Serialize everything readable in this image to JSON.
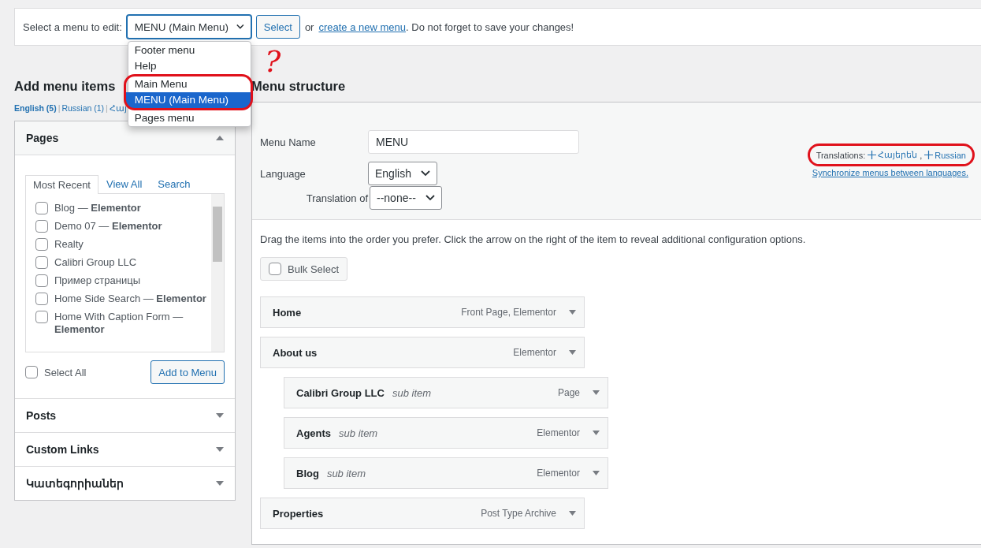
{
  "menu_picker": {
    "label": "Select a menu to edit:",
    "value": "MENU (Main Menu)",
    "button": "Select",
    "or_text": "or",
    "link": "create a new menu",
    "after_link": ". Do not forget to save your changes!",
    "options": [
      {
        "label": "Footer menu",
        "selected": false
      },
      {
        "label": "Help",
        "selected": false
      },
      {
        "label": "Main Menu",
        "selected": false,
        "circled": true
      },
      {
        "label": "MENU (Main Menu)",
        "selected": true,
        "circled": true
      },
      {
        "label": "Pages menu",
        "selected": false
      }
    ]
  },
  "add_items": {
    "heading": "Add menu items",
    "separator": "|",
    "languages": [
      {
        "label": "English (5)",
        "selected": true
      },
      {
        "label": "Russian (1)",
        "selected": false
      },
      {
        "label": "Հայ",
        "selected": false
      }
    ],
    "sections": [
      {
        "title": "Pages",
        "expanded": true
      },
      {
        "title": "Posts",
        "expanded": false
      },
      {
        "title": "Custom Links",
        "expanded": false
      },
      {
        "title": "Կատեգորիաներ",
        "expanded": false
      }
    ],
    "tabs": [
      {
        "label": "Most Recent",
        "selected": true
      },
      {
        "label": "View All",
        "selected": false
      },
      {
        "label": "Search",
        "selected": false
      }
    ],
    "pages": [
      {
        "label": "Blog — **Elementor**",
        "checked": false
      },
      {
        "label": "Demo 07 — **Elementor**",
        "checked": false
      },
      {
        "label": "Realty",
        "checked": false
      },
      {
        "label": "Calibri Group LLC",
        "checked": false
      },
      {
        "label": "Пример страницы",
        "checked": false
      },
      {
        "label": "Home Side Search — **Elementor**",
        "checked": false
      },
      {
        "label": "Home With Caption Form — **Elementor**",
        "checked": false
      }
    ],
    "select_all": {
      "label": "Select All",
      "checked": false
    },
    "add_button": "Add to Menu"
  },
  "structure": {
    "heading": "Menu structure",
    "name_label": "Menu Name",
    "name_value": "MENU",
    "language_label": "Language",
    "language_value": "English",
    "translation_label": "Translation of",
    "translation_value": "--none--",
    "translations": {
      "label": "Translations:",
      "links": [
        "Հայերեն",
        "Russian"
      ],
      "separator": ","
    },
    "sync_link": "Synchronize menus between languages.",
    "instructions": "Drag the items into the order you prefer. Click the arrow on the right of the item to reveal additional configuration options.",
    "bulk_select": {
      "label": "Bulk Select",
      "checked": false
    },
    "items": [
      {
        "title": "Home",
        "type": "Front Page, Elementor"
      },
      {
        "title": "About us",
        "type": "Elementor",
        "children": [
          {
            "title": "Calibri Group LLC",
            "note": "sub item",
            "type": "Page"
          },
          {
            "title": "Agents",
            "note": "sub item",
            "type": "Elementor"
          },
          {
            "title": "Blog",
            "note": "sub item",
            "type": "Elementor"
          }
        ]
      },
      {
        "title": "Properties",
        "type": "Post Type Archive"
      }
    ]
  },
  "annotation": {
    "mark": "?"
  }
}
